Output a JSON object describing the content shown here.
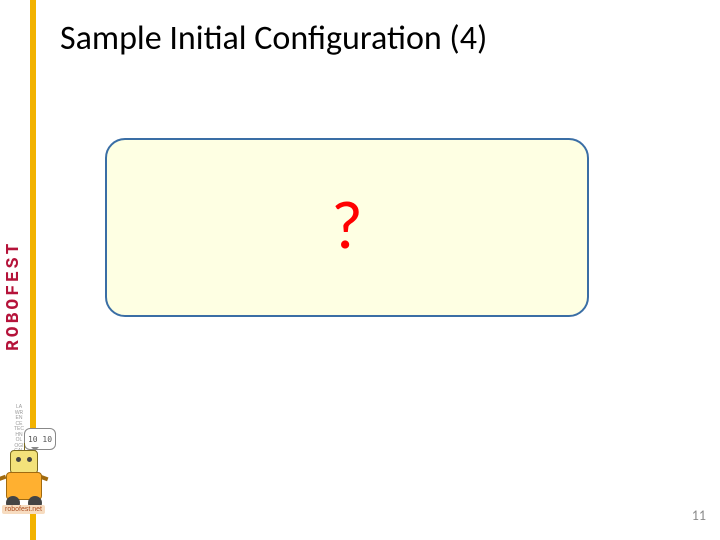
{
  "title": "Sample Initial Configuration (4)",
  "sidebar": {
    "brand": "ROBOFEST",
    "tagline": "LAWRENCE TECHNOLOGICAL UNIVERSITY"
  },
  "box": {
    "content": "?"
  },
  "robot": {
    "speech": "10 10",
    "tag": "robofest.net"
  },
  "page_number": "11"
}
